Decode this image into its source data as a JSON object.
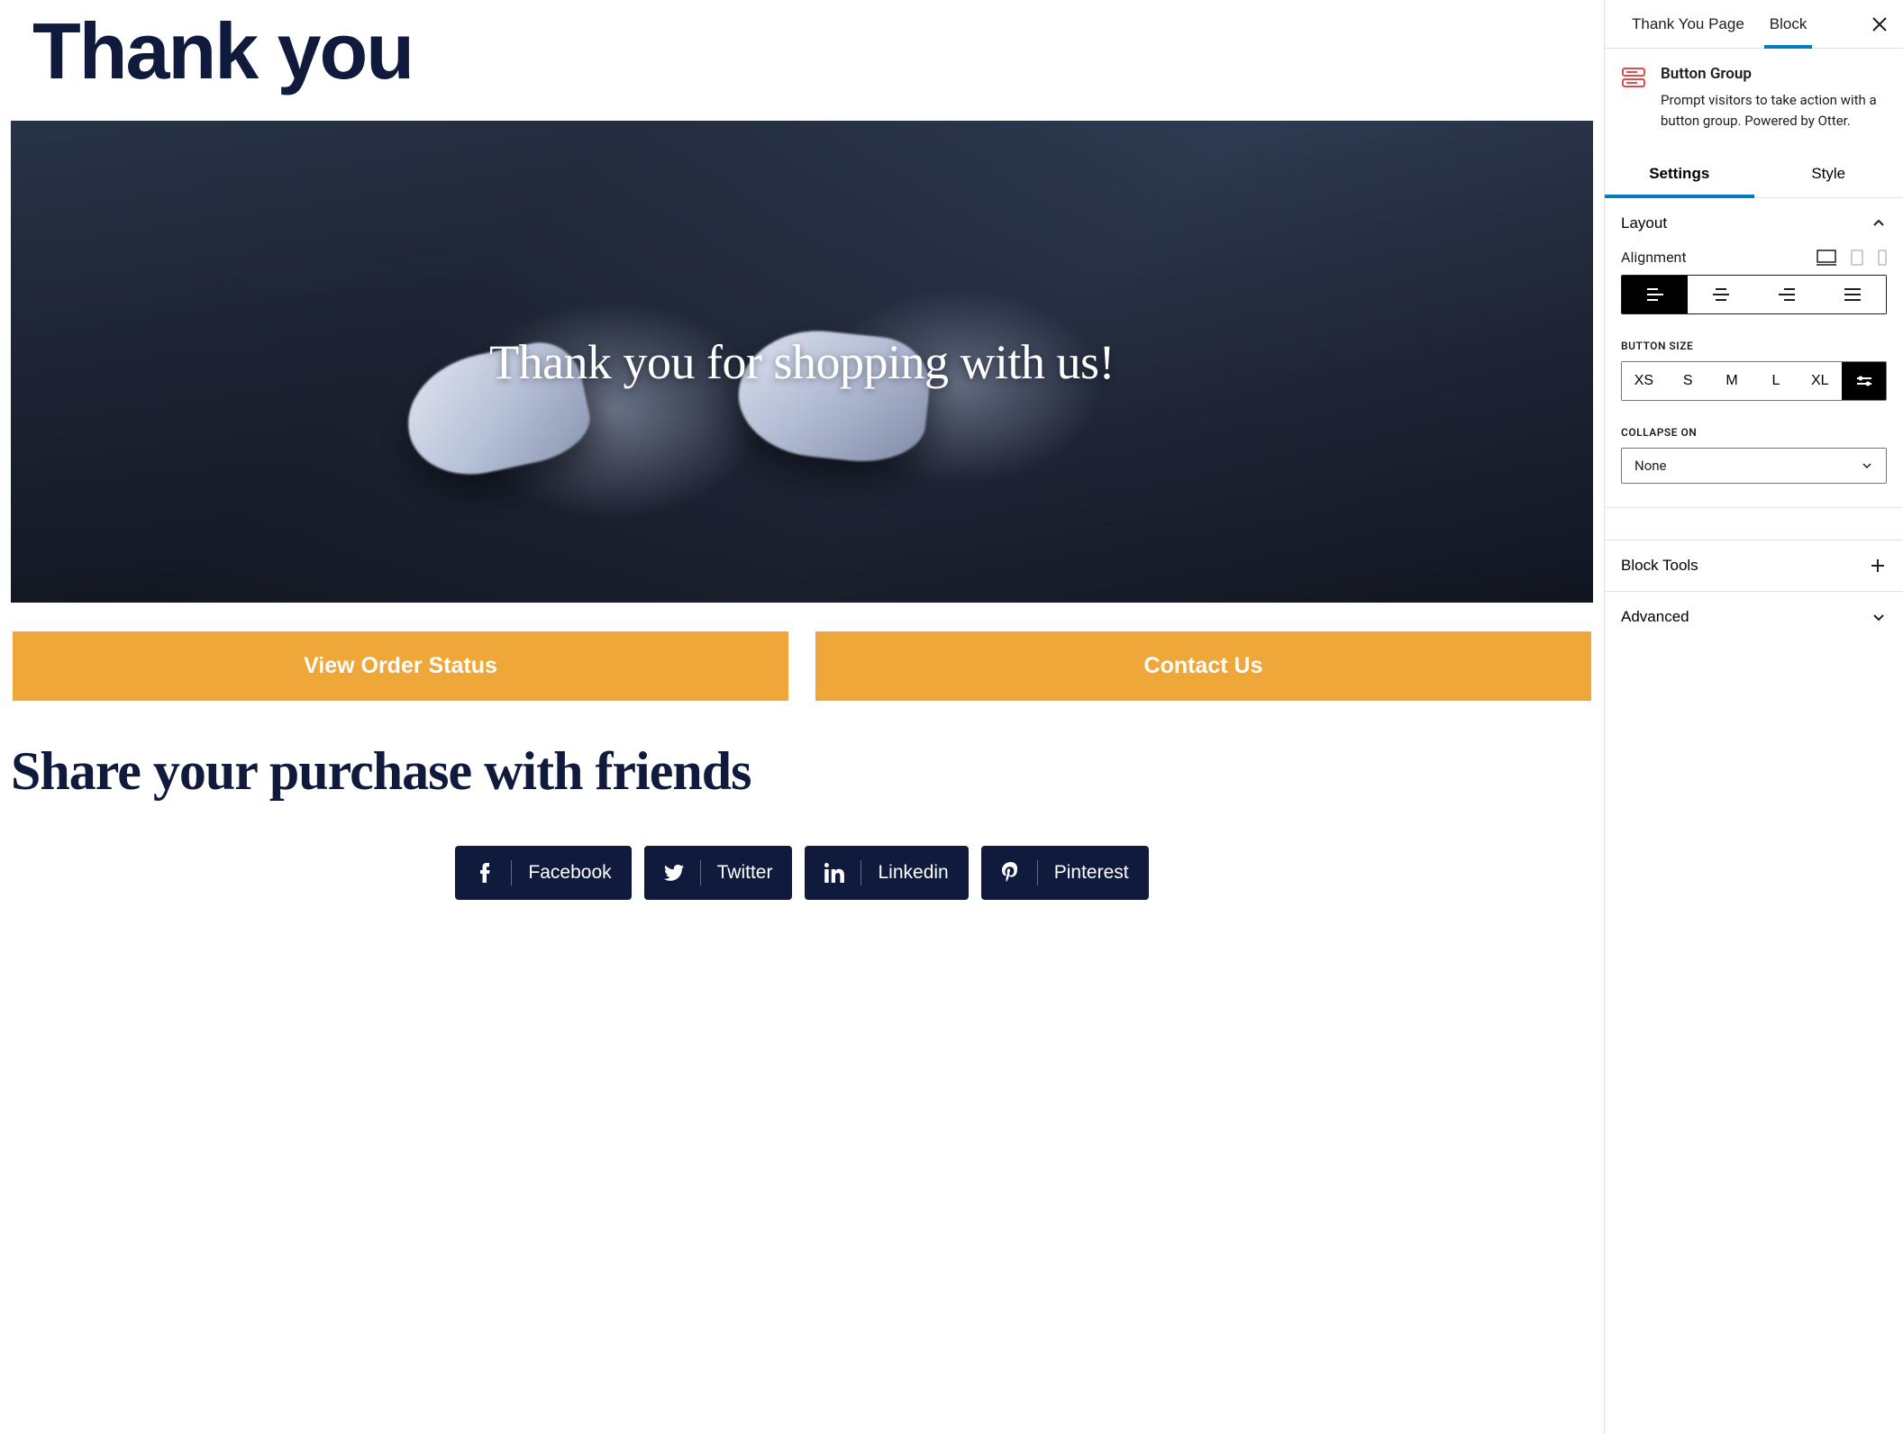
{
  "page": {
    "title": "Thank you",
    "heroText": "Thank you for shopping with us!",
    "buttons": {
      "viewOrder": "View Order Status",
      "contact": "Contact Us"
    },
    "shareHeading": "Share your purchase with friends",
    "social": {
      "facebook": "Facebook",
      "twitter": "Twitter",
      "linkedin": "Linkedin",
      "pinterest": "Pinterest"
    }
  },
  "sidebar": {
    "tabs": {
      "page": "Thank You Page",
      "block": "Block"
    },
    "block": {
      "title": "Button Group",
      "description": "Prompt visitors to take action with a button group. Powered by Otter."
    },
    "innerTabs": {
      "settings": "Settings",
      "style": "Style"
    },
    "panels": {
      "layout": "Layout",
      "blockTools": "Block Tools",
      "advanced": "Advanced"
    },
    "controls": {
      "alignment": "Alignment",
      "buttonSize": "BUTTON SIZE",
      "sizes": {
        "xs": "XS",
        "s": "S",
        "m": "M",
        "l": "L",
        "xl": "XL"
      },
      "collapseOn": "COLLAPSE ON",
      "collapseValue": "None"
    }
  }
}
